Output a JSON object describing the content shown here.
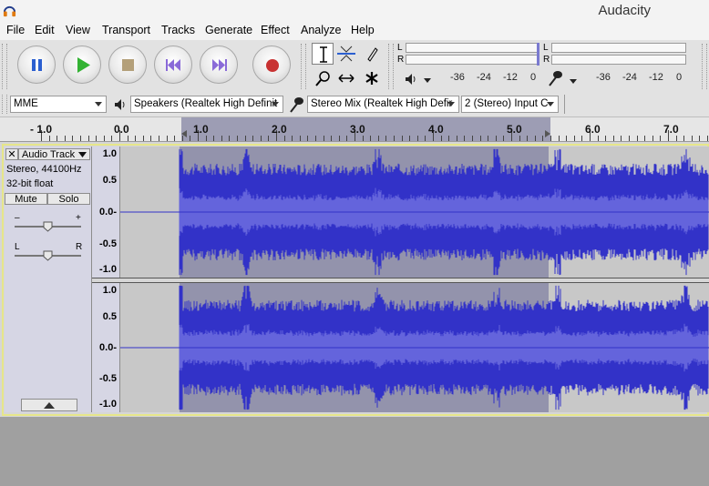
{
  "window": {
    "title": "Audacity"
  },
  "menu": [
    "File",
    "Edit",
    "View",
    "Transport",
    "Tracks",
    "Generate",
    "Effect",
    "Analyze",
    "Help"
  ],
  "transport": {
    "buttons": [
      "pause",
      "play",
      "stop",
      "skip-to-start",
      "skip-to-end",
      "record"
    ]
  },
  "meters": {
    "playback": {
      "left": "L",
      "right": "R",
      "scale": [
        "-36",
        "-24",
        "-12",
        "0"
      ]
    },
    "record": {
      "left": "L",
      "right": "R",
      "scale": [
        "-36",
        "-24",
        "-12",
        "0"
      ]
    }
  },
  "device": {
    "host": "MME",
    "output": "Speakers (Realtek High Definit",
    "input": "Stereo Mix (Realtek High Defir",
    "channels": "2 (Stereo) Input C"
  },
  "ruler": {
    "labels": [
      "- 1.0",
      "0.0",
      "1.0",
      "2.0",
      "3.0",
      "4.0",
      "5.0",
      "6.0",
      "7.0"
    ]
  },
  "track": {
    "name": "Audio Track",
    "rate": "Stereo, 44100Hz",
    "format": "32-bit float",
    "mute": "Mute",
    "solo": "Solo",
    "gain_minus": "–",
    "gain_plus": "+",
    "pan_left": "L",
    "pan_right": "R",
    "close": "✕",
    "scale": [
      "1.0",
      "0.5",
      "0.0-",
      "-0.5",
      "-1.0"
    ]
  },
  "colors": {
    "wave": "#3232c8",
    "wave_rms": "#6464dc",
    "selection": "#9393ac",
    "track_bg": "#c8c8c8"
  }
}
